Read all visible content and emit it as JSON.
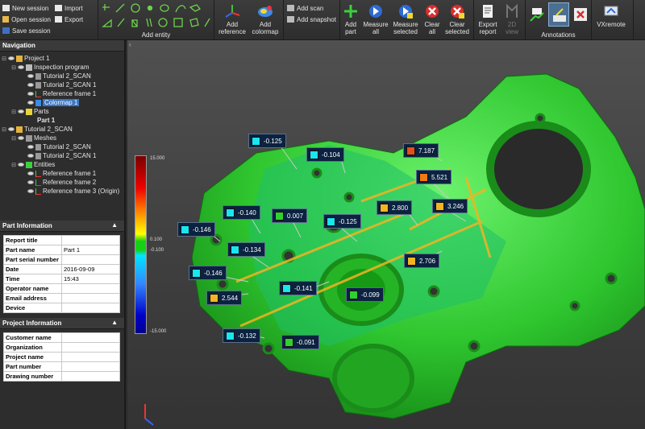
{
  "session": {
    "new": "New session",
    "open": "Open session",
    "save": "Save session",
    "import": "Import",
    "export": "Export"
  },
  "ribbon": {
    "add_entity": "Add entity",
    "add_reference": "Add reference",
    "add_colormap": "Add colormap",
    "add_scan": "Add scan",
    "add_snapshot": "Add snapshot",
    "add_part": "Add part",
    "measure_all": "Measure all",
    "measure_selected": "Measure selected",
    "clear_all": "Clear all",
    "clear_selected": "Clear selected",
    "export_report": "Export report",
    "view_2d": "2D view",
    "annotations": "Annotations",
    "vxremote": "VXremote"
  },
  "navigation": {
    "title": "Navigation",
    "nodes": [
      "Project 1",
      "Inspection program",
      "Tutorial 2_SCAN",
      "Tutorial 2_SCAN 1",
      "Reference frame 1",
      "Colormap 1",
      "Parts",
      "Part 1",
      "Tutorial 2_SCAN",
      "Meshes",
      "Tutorial 2_SCAN",
      "Tutorial 2_SCAN 1",
      "Entities",
      "Reference frame 1",
      "Reference frame 2",
      "Reference frame 3 (Origin)"
    ]
  },
  "part_info": {
    "title": "Part Information",
    "rows": [
      [
        "Report title",
        ""
      ],
      [
        "Part name",
        "Part 1"
      ],
      [
        "Part serial number",
        ""
      ],
      [
        "Date",
        "2016-09-09"
      ],
      [
        "Time",
        "15:43"
      ],
      [
        "Operator name",
        ""
      ],
      [
        "Email address",
        ""
      ],
      [
        "Device",
        ""
      ]
    ]
  },
  "project_info": {
    "title": "Project Information",
    "rows": [
      [
        "Customer name",
        ""
      ],
      [
        "Organization",
        ""
      ],
      [
        "Project name",
        ""
      ],
      [
        "Part number",
        ""
      ],
      [
        "Drawing number",
        ""
      ]
    ]
  },
  "colorbar": {
    "labels": [
      "15.000",
      "0.100",
      "-0.100",
      "-15.000"
    ]
  },
  "annotations": [
    {
      "value": "-0.125",
      "color": "#18e6f0"
    },
    {
      "value": "-0.104",
      "color": "#18e6f0"
    },
    {
      "value": "7.187",
      "color": "#e4501a"
    },
    {
      "value": "5.521",
      "color": "#ef7a12"
    },
    {
      "value": "2.800",
      "color": "#f2b423"
    },
    {
      "value": "3.246",
      "color": "#f2b423"
    },
    {
      "value": "-0.140",
      "color": "#18e6f0"
    },
    {
      "value": "0.007",
      "color": "#2fd12f"
    },
    {
      "value": "-0.125",
      "color": "#18e6f0"
    },
    {
      "value": "-0.146",
      "color": "#18e6f0"
    },
    {
      "value": "-0.134",
      "color": "#18e6f0"
    },
    {
      "value": "2.706",
      "color": "#f2b423"
    },
    {
      "value": "-0.146",
      "color": "#18e6f0"
    },
    {
      "value": "-0.141",
      "color": "#18e6f0"
    },
    {
      "value": "2.544",
      "color": "#f2b423"
    },
    {
      "value": "-0.099",
      "color": "#2fd12f"
    },
    {
      "value": "-0.132",
      "color": "#18e6f0"
    },
    {
      "value": "-0.091",
      "color": "#2fd12f"
    }
  ]
}
